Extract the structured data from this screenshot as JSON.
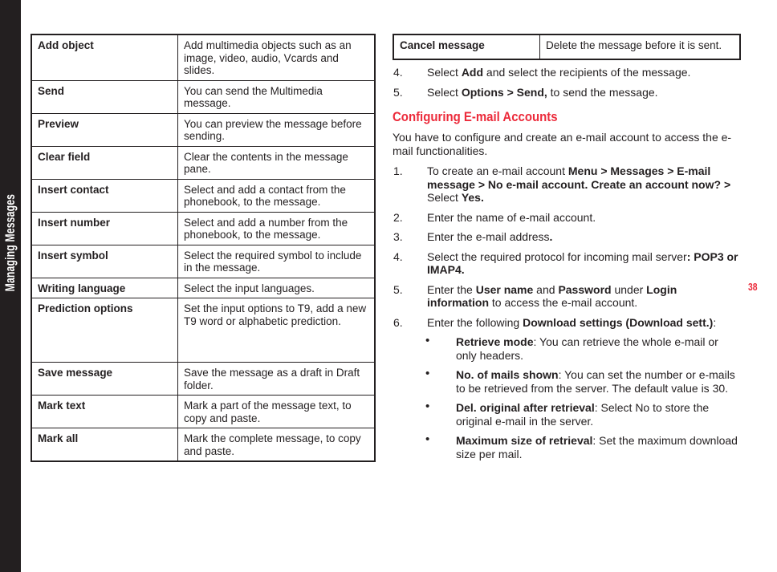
{
  "sidebar": {
    "label": "Managing Messages"
  },
  "page": {
    "number": "38"
  },
  "left_column": {
    "table": {
      "rows": [
        {
          "option": "Add object",
          "description": "Add multimedia objects such as an image, video, audio, Vcards and slides."
        },
        {
          "option": "Send",
          "description": " You can send the Multimedia message."
        },
        {
          "option": "Preview",
          "description": "You can preview the message before sending."
        },
        {
          "option": "Clear field",
          "description": "Clear the contents in the message pane."
        },
        {
          "option": "Insert contact",
          "description": "Select and add a contact from the phonebook, to the message."
        },
        {
          "option": "Insert number",
          "description": "Select and add a number from the phonebook, to the message."
        },
        {
          "option": "Insert symbol",
          "description": "Select the required symbol to include in the message."
        },
        {
          "option": "Writing language",
          "description": "Select the input languages."
        },
        {
          "option": "Prediction options",
          "description": "Set the input options to T9, add a new T9 word or alphabetic prediction."
        },
        {
          "option": "Save message",
          "description": "Save the message as a draft in Draft folder."
        },
        {
          "option": "Mark text",
          "description": "Mark a part of the message text, to copy and paste."
        },
        {
          "option": "Mark all",
          "description": "Mark the complete message, to copy and paste."
        }
      ]
    }
  },
  "right_column": {
    "table": {
      "rows": [
        {
          "option": "Cancel message",
          "description": "Delete the message before it is sent."
        }
      ]
    },
    "steps_mms": [
      {
        "num": "4.",
        "html": "Select <b>Add</b> and select the recipients of the message."
      },
      {
        "num": "5.",
        "html": "Select <b>Options &gt; Send,</b> to send the message."
      }
    ],
    "section_heading": "Configuring E-mail Accounts",
    "intro": "You have to configure and create an e-mail account to access the e-mail functionalities.",
    "steps_email": [
      {
        "num": "1.",
        "html": "To create an e-mail account <b>Menu &gt; Messages &gt; E-mail message &gt; No e-mail account. Create an account now? &gt;</b> Select <b>Yes.</b>"
      },
      {
        "num": "2.",
        "html": "Enter the name of e-mail account."
      },
      {
        "num": "3.",
        "html": "Enter the e-mail address<b>.</b>"
      },
      {
        "num": "4.",
        "html": "Select the required protocol for incoming mail server<b>: POP3 or IMAP4.</b>"
      },
      {
        "num": "5.",
        "html": "Enter the <b>User name</b> and <b>Password</b> under <b>Login information</b> to access the e-mail account."
      },
      {
        "num": "6.",
        "html": "Enter the following <b>Download settings (Download sett.)</b>:"
      }
    ],
    "bullets": [
      {
        "dot": "•",
        "html": "<b>Retrieve mode</b>: You can retrieve the whole e-mail or only headers."
      },
      {
        "dot": "•",
        "html": "<b>No. of mails shown</b>:  You can set the number or e-mails to be retrieved  from the server. The default value is 30."
      },
      {
        "dot": "•",
        "html": "<b>Del. original after retrieval</b>: Select No to store the original e-mail in the server."
      },
      {
        "dot": "•",
        "html": "<b>Maximum size of retrieval</b>: Set the maximum download size per mail."
      }
    ]
  },
  "colors": {
    "accent_red": "#ec2b3b",
    "spine_dark": "#231f20",
    "text": "#231f20"
  }
}
